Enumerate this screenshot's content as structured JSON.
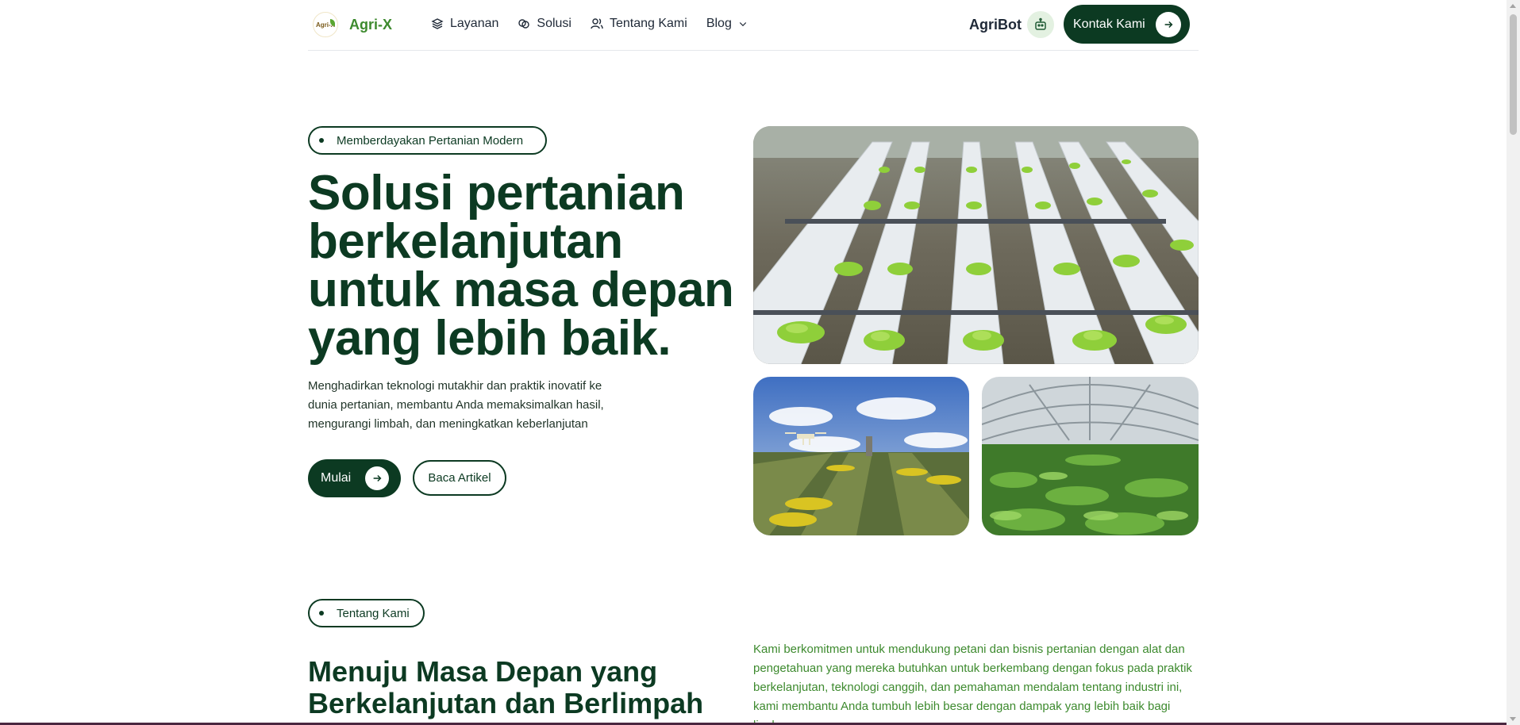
{
  "header": {
    "logo_text": "Agri-X",
    "brand": "Agri-X",
    "nav": [
      {
        "label": "Layanan",
        "icon": "layers-icon"
      },
      {
        "label": "Solusi",
        "icon": "link-icon"
      },
      {
        "label": "Tentang Kami",
        "icon": "users-icon"
      },
      {
        "label": "Blog",
        "icon": "chevron-down-icon"
      }
    ],
    "agribot_label": "AgriBot",
    "agribot_icon": "robot-icon",
    "contact_label": "Kontak Kami"
  },
  "hero": {
    "badge": "Memberdayakan Pertanian Modern",
    "title": "Solusi pertanian berkelanjutan untuk masa depan yang lebih baik.",
    "description": "Menghadirkan teknologi mutakhir dan praktik inovatif ke dunia pertanian, membantu Anda memaksimalkan hasil, mengurangi limbah, dan meningkatkan keberlanjutan",
    "primary_button": "Mulai",
    "secondary_button": "Baca Artikel"
  },
  "about": {
    "badge": "Tentang Kami",
    "title": "Menuju Masa Depan yang Berkelanjutan dan Berlimpah",
    "description": "Kami berkomitmen untuk mendukung petani dan bisnis pertanian dengan alat dan pengetahuan yang mereka butuhkan untuk berkembang dengan fokus pada praktik berkelanjutan, teknologi canggih, dan pemahaman mendalam tentang industri ini, kami membantu Anda tumbuh lebih besar dengan dampak yang lebih baik bagi lingkungan."
  },
  "colors": {
    "primary": "#0c3a22",
    "brand_green": "#3d8a2e",
    "agribot_bg": "#e3f1e1"
  }
}
